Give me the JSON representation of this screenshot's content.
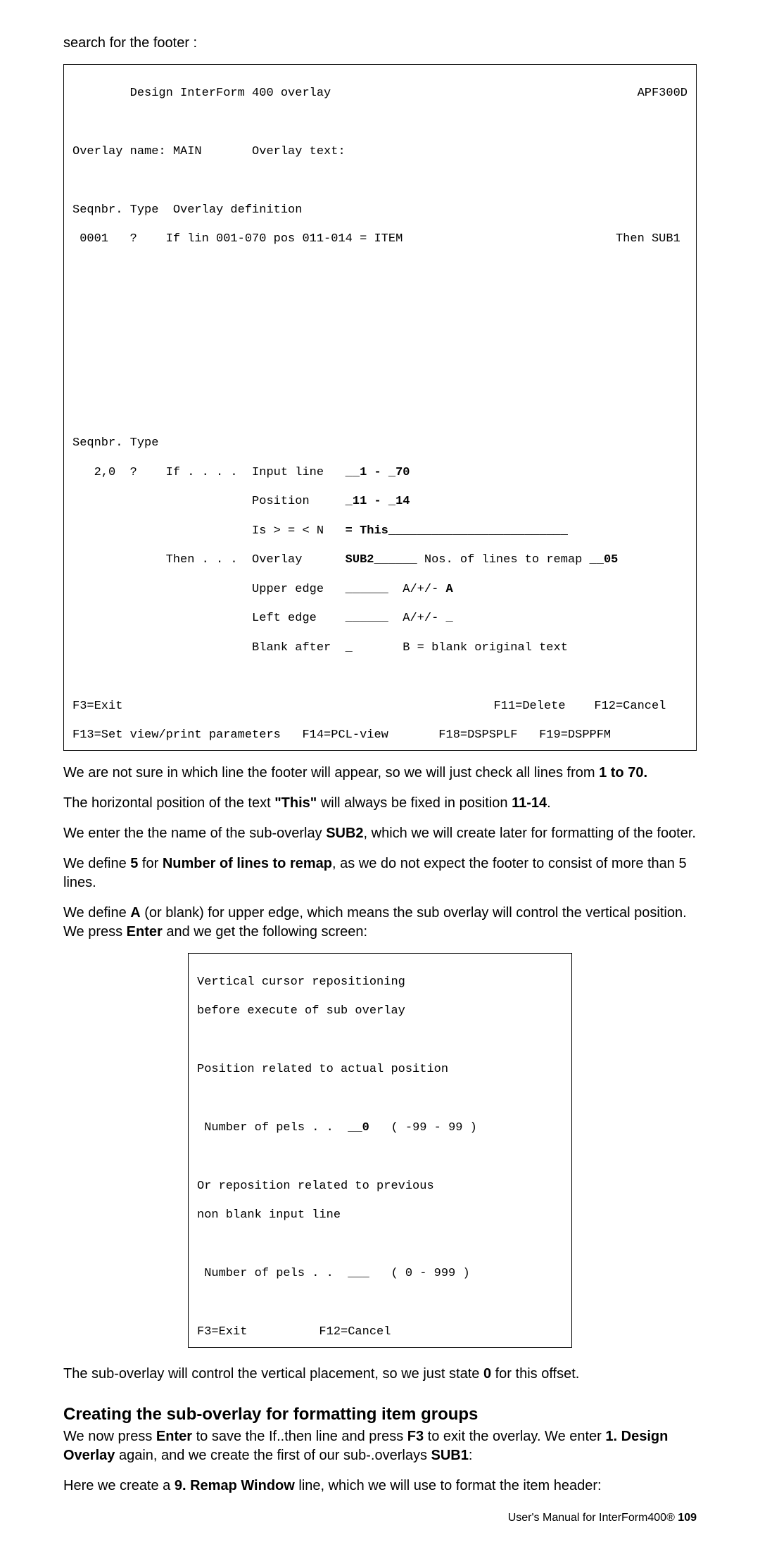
{
  "intro": "search for the footer :",
  "term1": {
    "title_left": "        Design InterForm 400 overlay",
    "title_right": "APF300D",
    "overlay_name_line": "Overlay name: MAIN       Overlay text:",
    "header1": "Seqnbr. Type  Overlay definition",
    "rule_line_left": " 0001   ?    If lin 001-070 pos 011-014 = ITEM",
    "rule_line_right": "Then SUB1 ",
    "seqnbr_type": "Seqnbr. Type",
    "if_input_line": "   2,0  ?    If . . . .  Input line   ",
    "if_input_val": "__1 - _70",
    "pos_label": "                         Position     ",
    "pos_val": "_11 - _14",
    "is_label": "                         Is > = < N   ",
    "is_val": "= This_________________________",
    "then_label": "             Then . . .  Overlay      ",
    "then_sub": "SUB2______",
    "then_rest1": " Nos. of lines to remap ",
    "then_rest2": "__05",
    "upper_label": "                         Upper edge   ______  A/+/- ",
    "upper_val": "A",
    "left_label": "                         Left edge    ______  A/+/- _",
    "blank_label": "                         Blank after  _       B = blank original text",
    "fkeys1_left": "F3=Exit",
    "fkeys1_right": "F11=Delete    F12=Cancel   ",
    "fkeys2": "F13=Set view/print parameters   F14=PCL-view       F18=DSPSPLF   F19=DSPPFM"
  },
  "para1a": "We are not sure in which line the footer will appear, so we will just check all lines from ",
  "para1b": "1 to 70.",
  "para2a": "The horizontal position of the text ",
  "para2b": "\"This\"",
  "para2c": " will always be fixed in position ",
  "para2d": "11-14",
  "para2e": ".",
  "para3a": "We enter the the name of the sub-overlay ",
  "para3b": "SUB2",
  "para3c": ", which we will create later for formatting of the footer.",
  "para4a": "We define ",
  "para4b": "5",
  "para4c": " for ",
  "para4d": "Number of lines to remap",
  "para4e": ", as we do not expect the footer to consist of more than 5 lines.",
  "para5a": "We define ",
  "para5b": "A",
  "para5c": " (or blank)  for upper edge, which means the sub overlay will control the vertical position. We press ",
  "para5d": "Enter",
  "para5e": " and we get the following screen:",
  "term2": {
    "l1": "Vertical cursor repositioning",
    "l2": "before execute of sub overlay",
    "l3": "Position related to actual position",
    "l4a": " Number of pels . .  ",
    "l4b": "__0",
    "l4c": "   ( -99 - 99 )",
    "l5": "Or reposition related to previous",
    "l6": "non blank input line",
    "l7": " Number of pels . .  ___   ( 0 - 999 )",
    "l8": "F3=Exit          F12=Cancel"
  },
  "para6a": "The sub-overlay will control the vertical placement, so we just state ",
  "para6b": "0",
  "para6c": " for this offset.",
  "heading": "Creating the sub-overlay for formatting item groups",
  "para7a": "We now press ",
  "para7b": "Enter",
  "para7c": " to save the If..then line and press ",
  "para7d": "F3",
  "para7e": " to exit the overlay. We enter ",
  "para7f": "1. Design Overlay",
  "para7g": " again, and we create the first of our sub-.overlays ",
  "para7h": "SUB1",
  "para7i": ":",
  "para8a": "Here we create a ",
  "para8b": "9. Remap Window",
  "para8c": " line, which we will use to format the item header:",
  "footer_text": "User's Manual for InterForm400®   ",
  "footer_page": "109"
}
